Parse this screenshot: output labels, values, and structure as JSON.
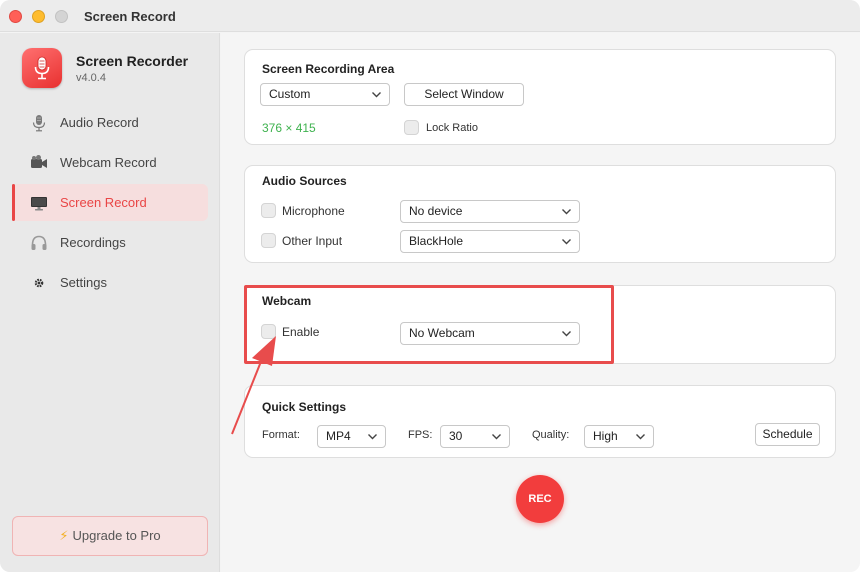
{
  "window": {
    "title": "Screen Record"
  },
  "app": {
    "name": "Screen Recorder",
    "version": "v4.0.4"
  },
  "sidebar": {
    "items": [
      {
        "label": "Audio Record",
        "icon": "microphone-icon",
        "active": false
      },
      {
        "label": "Webcam Record",
        "icon": "video-camera-icon",
        "active": false
      },
      {
        "label": "Screen Record",
        "icon": "monitor-icon",
        "active": true
      },
      {
        "label": "Recordings",
        "icon": "headphones-icon",
        "active": false
      },
      {
        "label": "Settings",
        "icon": "gear-icon",
        "active": false
      }
    ],
    "upgrade_label": "Upgrade to Pro"
  },
  "recording_area": {
    "title": "Screen Recording Area",
    "mode": "Custom",
    "select_window_label": "Select Window",
    "dimensions": "376 × 415",
    "lock_ratio_label": "Lock Ratio",
    "lock_ratio_checked": false
  },
  "audio_sources": {
    "title": "Audio Sources",
    "microphone_label": "Microphone",
    "microphone_device": "No device",
    "other_input_label": "Other Input",
    "other_input_device": "BlackHole"
  },
  "webcam": {
    "title": "Webcam",
    "enable_label": "Enable",
    "device": "No Webcam"
  },
  "quick_settings": {
    "title": "Quick Settings",
    "format_label": "Format:",
    "format_value": "MP4",
    "fps_label": "FPS:",
    "fps_value": "30",
    "quality_label": "Quality:",
    "quality_value": "High",
    "schedule_label": "Schedule"
  },
  "rec_label": "REC",
  "colors": {
    "accent": "#e94646",
    "rec_button": "#f23d3d",
    "dimension_text": "#3fb24f",
    "annotation": "#e84c4c"
  }
}
